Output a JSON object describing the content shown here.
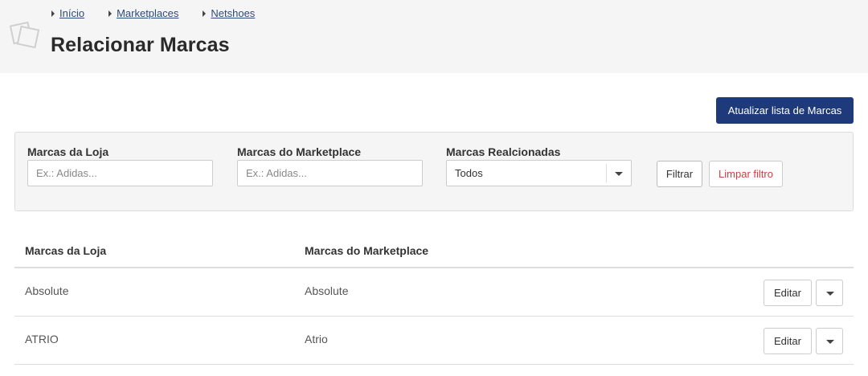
{
  "breadcrumb": [
    "Início",
    "Marketplaces",
    "Netshoes"
  ],
  "page_title": "Relacionar Marcas",
  "actions": {
    "update_button": "Atualizar lista de Marcas"
  },
  "filters": {
    "store_brands": {
      "label": "Marcas da Loja",
      "placeholder": "Ex.: Adidas..."
    },
    "marketplace_brands": {
      "label": "Marcas do Marketplace",
      "placeholder": "Ex.: Adidas..."
    },
    "related": {
      "label": "Marcas Realcionadas",
      "selected": "Todos"
    },
    "filter_button": "Filtrar",
    "clear_button": "Limpar filtro"
  },
  "table": {
    "headers": [
      "Marcas da Loja",
      "Marcas do Marketplace"
    ],
    "rows": [
      {
        "store": "Absolute",
        "marketplace": "Absolute",
        "edit": "Editar"
      },
      {
        "store": "ATRIO",
        "marketplace": "Atrio",
        "edit": "Editar"
      }
    ]
  },
  "colors": {
    "primary": "#1f3a7a",
    "danger": "#c94040",
    "header_bg": "#f5f5f5"
  },
  "icons": {
    "page_icon": "stacked-pages-icon",
    "breadcrumb_arrow": "caret-right-icon",
    "dropdown": "caret-down-icon"
  }
}
